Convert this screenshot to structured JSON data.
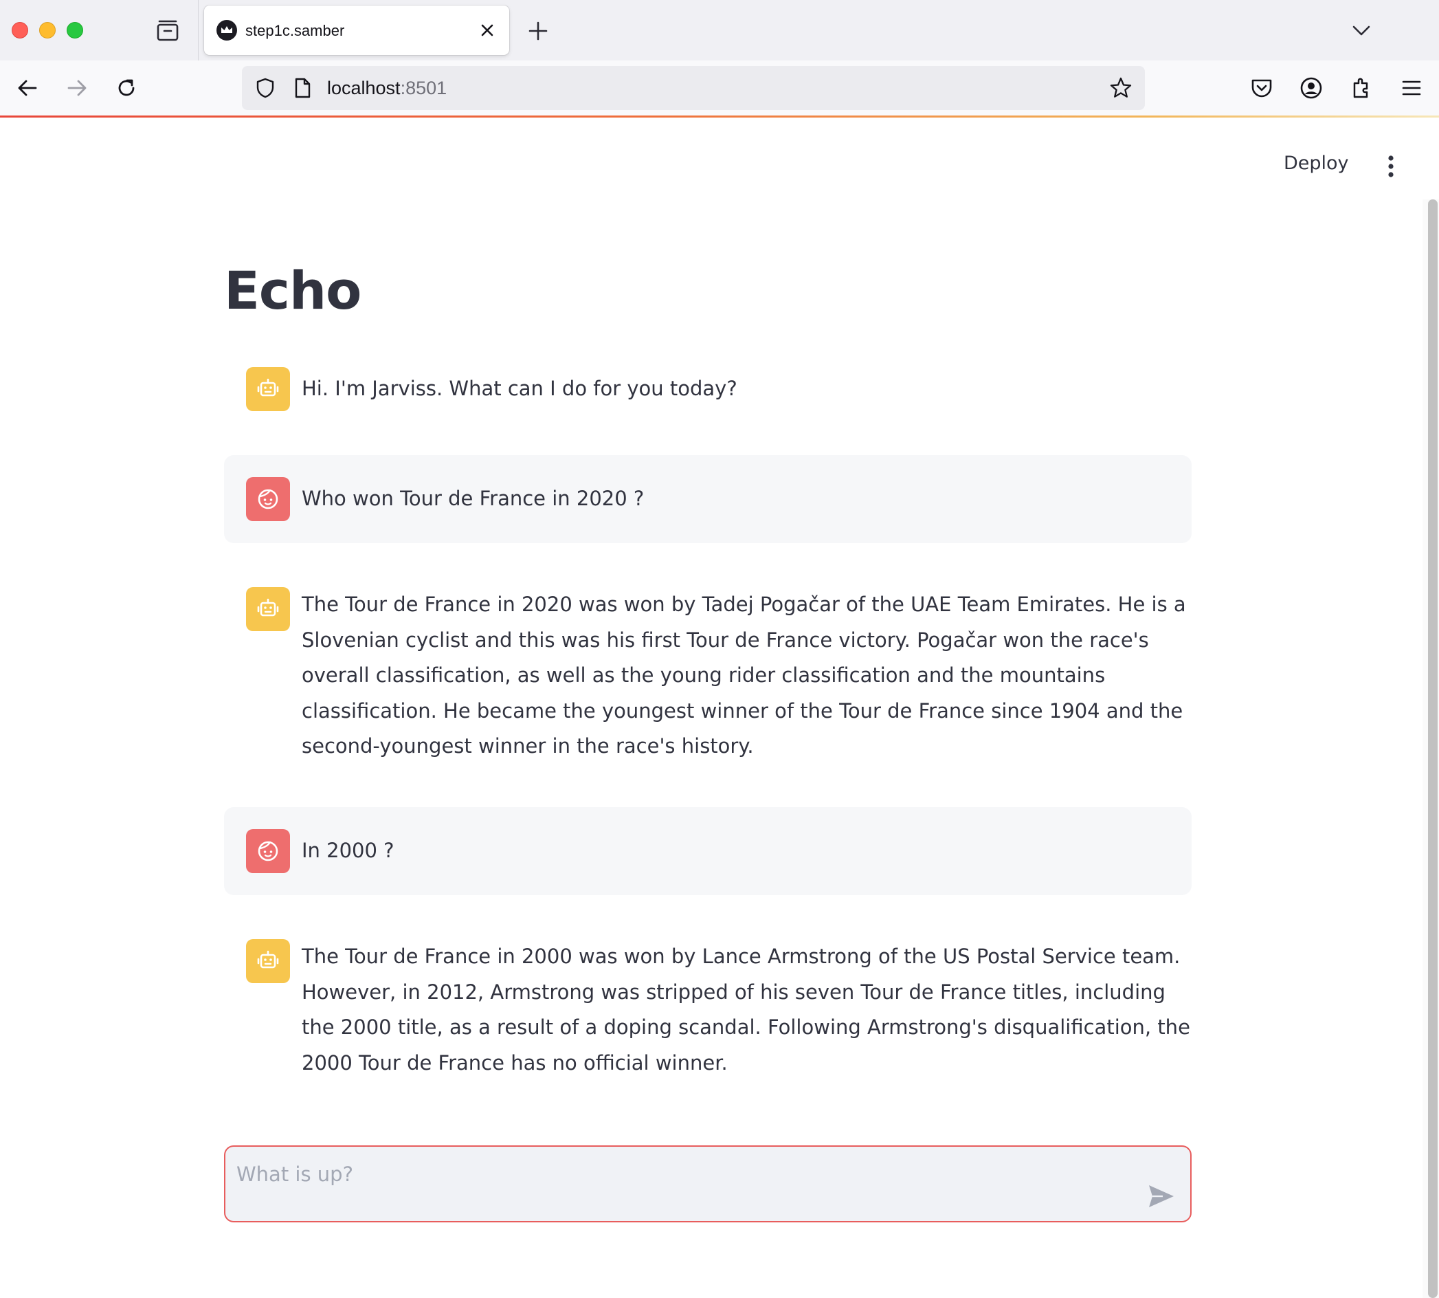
{
  "browser": {
    "tab": {
      "title": "step1c.samber"
    },
    "url": {
      "host": "localhost",
      "port": ":8501"
    }
  },
  "header": {
    "deploy_label": "Deploy"
  },
  "page": {
    "title": "Echo"
  },
  "messages": [
    {
      "role": "assistant",
      "avatar_icon": "robot-icon",
      "text": "Hi. I'm Jarviss. What can I do for you today?"
    },
    {
      "role": "user",
      "avatar_icon": "face-icon",
      "text": "Who won Tour de France in 2020 ?"
    },
    {
      "role": "assistant",
      "avatar_icon": "robot-icon",
      "text": "The Tour de France in 2020 was won by Tadej Pogačar of the UAE Team Emirates. He is a Slovenian cyclist and this was his first Tour de France victory. Pogačar won the race's overall classification, as well as the young rider classification and the mountains classification. He became the youngest winner of the Tour de France since 1904 and the second-youngest winner in the race's history."
    },
    {
      "role": "user",
      "avatar_icon": "face-icon",
      "text": "In 2000 ?"
    },
    {
      "role": "assistant",
      "avatar_icon": "robot-icon",
      "text": "The Tour de France in 2000 was won by Lance Armstrong of the US Postal Service team. However, in 2012, Armstrong was stripped of his seven Tour de France titles, including the 2000 title, as a result of a doping scandal. Following Armstrong's disqualification, the 2000 Tour de France has no official winner."
    }
  ],
  "chat_input": {
    "placeholder": "What is up?",
    "value": ""
  },
  "colors": {
    "assistant_avatar": "#f7c64e",
    "user_avatar": "#ee6e6e",
    "input_border": "#e85d5d",
    "user_bubble": "#f6f7f9"
  }
}
